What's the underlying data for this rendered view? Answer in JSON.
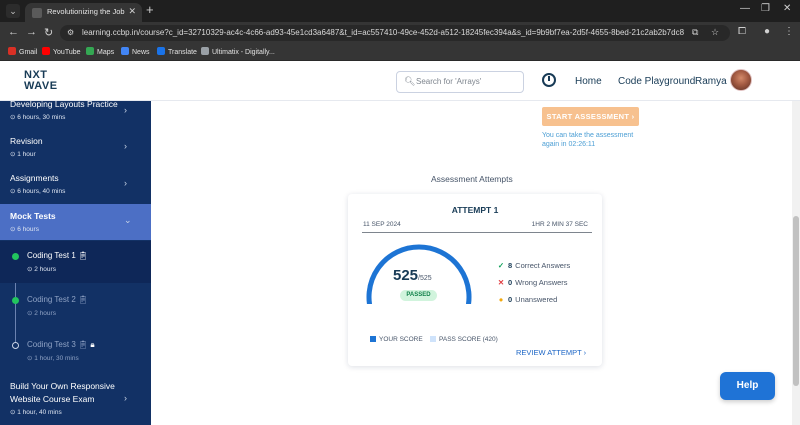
{
  "browser": {
    "tab_title": "Revolutionizing the Job Market",
    "url": "learning.ccbp.in/course?c_id=32710329-ac4c-4c66-ad93-45e1cd3a6487&t_id=ac557410-49ce-452d-a512-18245fec394a&s_id=9b9bf7ea-2d5f-4655-8bed-21c2ab2b7dc8",
    "bookmarks": [
      "Gmail",
      "YouTube",
      "Maps",
      "News",
      "Translate",
      "Ultimatix - Digitally..."
    ]
  },
  "header": {
    "logo_line1": "NXT",
    "logo_line2": "WAVE",
    "search_placeholder": "Search for 'Arrays'",
    "nav_home": "Home",
    "nav_playground": "Code Playground",
    "user_name": "Ramya"
  },
  "sidebar": {
    "items": [
      {
        "title": "Developing Layouts Practice",
        "duration": "6 hours, 30 mins"
      },
      {
        "title": "Revision",
        "duration": "1 hour"
      },
      {
        "title": "Assignments",
        "duration": "6 hours, 40 mins"
      },
      {
        "title": "Mock Tests",
        "duration": "6 hours"
      },
      {
        "title": "Build Your Own Responsive",
        "title2": "Website Course Exam",
        "duration": "1 hour, 40 mins"
      }
    ],
    "sub_items": [
      {
        "title": "Coding Test 1",
        "duration": "2 hours"
      },
      {
        "title": "Coding Test 2",
        "duration": "2 hours"
      },
      {
        "title": "Coding Test 3",
        "duration": "1 hour, 30 mins"
      }
    ]
  },
  "assessment": {
    "start_label": "START ASSESSMENT",
    "retry_note": "You can take the assessment again in 02:26:11",
    "attempts_title": "Assessment Attempts",
    "attempt": {
      "label": "ATTEMPT 1",
      "date": "11 SEP 2024",
      "duration": "1HR 2 MIN 37 SEC",
      "score": "525",
      "max_score": "/525",
      "score_fraction": 1.0,
      "status": "PASSED",
      "correct_count": "8",
      "correct_label": "Correct Answers",
      "wrong_count": "0",
      "wrong_label": "Wrong Answers",
      "unanswered_count": "0",
      "unanswered_label": "Unanswered",
      "legend_your_score": "YOUR SCORE",
      "legend_pass_score": "PASS SCORE (420)",
      "review_label": "REVIEW ATTEMPT"
    }
  },
  "colors": {
    "sidebar_bg": "#123165",
    "sidebar_active": "#4c6fc5",
    "gauge_score": "#1d74d4",
    "gauge_track": "#cfe3fb",
    "correct": "#10a05a",
    "wrong": "#e0393e",
    "unanswered": "#f2a90f",
    "start_btn": "#f7c18f",
    "help_btn": "#1f73d6"
  },
  "help_label": "Help"
}
